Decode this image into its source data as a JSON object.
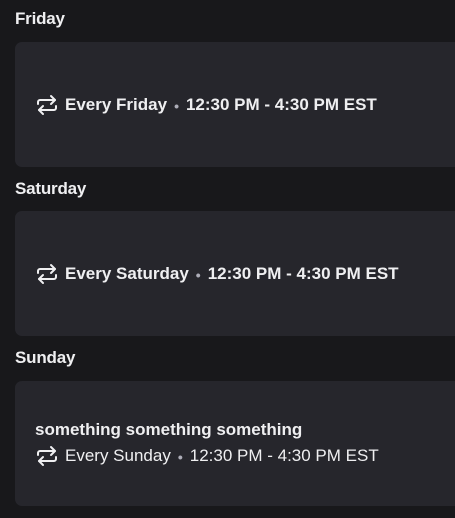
{
  "days": [
    {
      "heading": "Friday",
      "recurrence": "Every Friday",
      "time_range": "12:30 PM - 4:30 PM EST",
      "separator": "•"
    },
    {
      "heading": "Saturday",
      "recurrence": "Every Saturday",
      "time_range": "12:30 PM - 4:30 PM EST",
      "separator": "•"
    },
    {
      "heading": "Sunday",
      "title": "something something something",
      "recurrence": "Every Sunday",
      "time_range": "12:30 PM - 4:30 PM EST",
      "separator": "•"
    }
  ],
  "icons": {
    "repeat": "repeat-icon"
  },
  "colors": {
    "background": "#18181b",
    "card": "#26262c",
    "text": "#efeff1",
    "muted": "#adadb8"
  }
}
